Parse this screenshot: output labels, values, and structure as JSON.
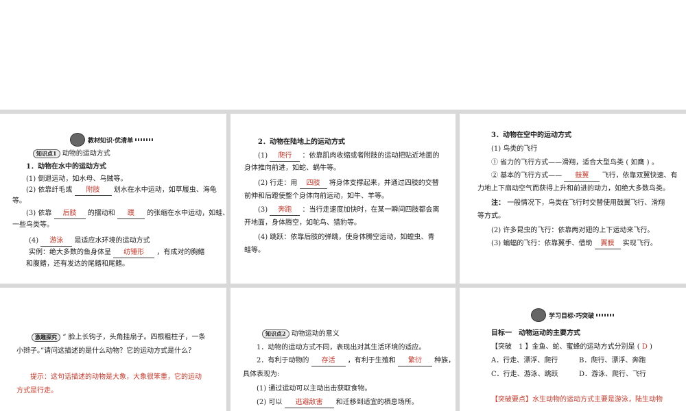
{
  "p1": {
    "banner": "教材知识·优清单",
    "kp_badge": "知识点1",
    "kp_title": "动物的运动方式",
    "h1": "1．动物在水中的运动方式",
    "l1": "(1) 倒退运动，如水母、乌贼等。",
    "l2a": "(2) 依靠纤毛或",
    "l2b": "附肢",
    "l2c": "划水在水中运动，如草履虫、海龟",
    "l2d": "等。",
    "l3a": "(3) 依靠",
    "l3b": "后肢",
    "l3c": "的摆动和",
    "l3d": "蹼",
    "l3e": "的张缩在水中运动，如蛙、",
    "l3f": "一些鸟类等。",
    "l4a": "(4)",
    "l4b": "游泳",
    "l4c": "是适应水环境的运动方式",
    "l5a": "实例：绝大多数的鱼身体呈",
    "l5b": "纺锤形",
    "l5c": "，有成对的胸鳍",
    "l6": "和腹鳍，还有发达的尾鳍和尾鳍。"
  },
  "p2": {
    "h": "2．动物在陆地上的运动方式",
    "l1a": "(1)",
    "l1b": "爬行",
    "l1c": "：依靠肌肉收缩或者附肢的运动把贴近地面的",
    "l1d": "身体推向前进，如蛇、蜗牛等。",
    "l2a": "(2) 行走：用",
    "l2b": "四肢",
    "l2c": "将身体支撑起来，并通过四肢的交替",
    "l2d": "前伸和后蹬使整个身体向前运动，如牛、羊等。",
    "l3a": "(3)",
    "l3b": "奔跑",
    "l3c": "：当行走速度加快时，在某一瞬间四肢都会离",
    "l3d": "开地面，身体腾空，如鸵鸟、猎豹等。",
    "l4": "(4) 跳跃：依靠后肢的弹跳，使身体腾空运动，如蝗虫、青",
    "l4b": "蛙等。"
  },
  "p3": {
    "h": "3．动物在空中的运动方式",
    "l1": "(1) 鸟类的飞行",
    "l2": "① 省力的飞行方式——滑翔，适合大型鸟类 ( 如鹰 ) 。",
    "l3a": "② 基本的飞行方式——",
    "l3b": "鼓翼",
    "l3c": "飞行，依靠双翼快速、有",
    "l3d": "力地上下扇动空气而获得上升和前进的动力，如绝大多数鸟类。",
    "l4a": "注：",
    "l4b": "一般情况下，鸟类在飞行时交替使用鼓翼飞行、滑翔",
    "l4c": "等方式。",
    "l5": "(2) 许多昆虫的飞行：依靠两对翅的上下运动来飞行。",
    "l6a": "(3) 蝙蝠的飞行：依靠翼手、借助",
    "l6b": "翼膜",
    "l6c": "实现飞行。"
  },
  "p4": {
    "badge": "激趣探究",
    "q1": "“ 脸上长钩子，头角挂扇子。四根粗柱子，一条",
    "q2": "小辫子。”请问这描述的是什么动物？它的运动方式是什么？",
    "a1": "提示：这句话描述的动物是大象，大象很笨重，它的运动",
    "a2": "方式是行走。"
  },
  "p5": {
    "kp_badge": "知识点2",
    "kp_title": "动物运动的意义",
    "l1": "1．动物的运动方式不同，表现出对其生活环境的适应。",
    "l2a": "2．有利于动物的",
    "l2b": "存活",
    "l2c": "，有利于生殖和",
    "l2d": "繁衍",
    "l2e": "种族，",
    "l2f": "具体表现为:",
    "l3": "(1) 通过运动可以主动出击获取食物。",
    "l4a": "(2) 可以",
    "l4b": "逃避敌害",
    "l4c": "和迁移到适宜的栖息场所。"
  },
  "p6": {
    "banner": "学习目标·巧突破",
    "goal": "目标一　动物运动的主要方式",
    "q_a": "【突破　1 】金鱼、蛇、蜜蜂的运动方式分别是 (",
    "q_ans": "D",
    "q_b": ")",
    "oA": "A．行走、漂浮、爬行",
    "oB": "B．爬行、漂浮、奔跑",
    "oC": "C．行走、游泳、跳跃",
    "oD": "D．游泳、爬行、飞行",
    "tip": "【突破要点】水生动物的运动方式主要是游泳，陆生动物"
  }
}
